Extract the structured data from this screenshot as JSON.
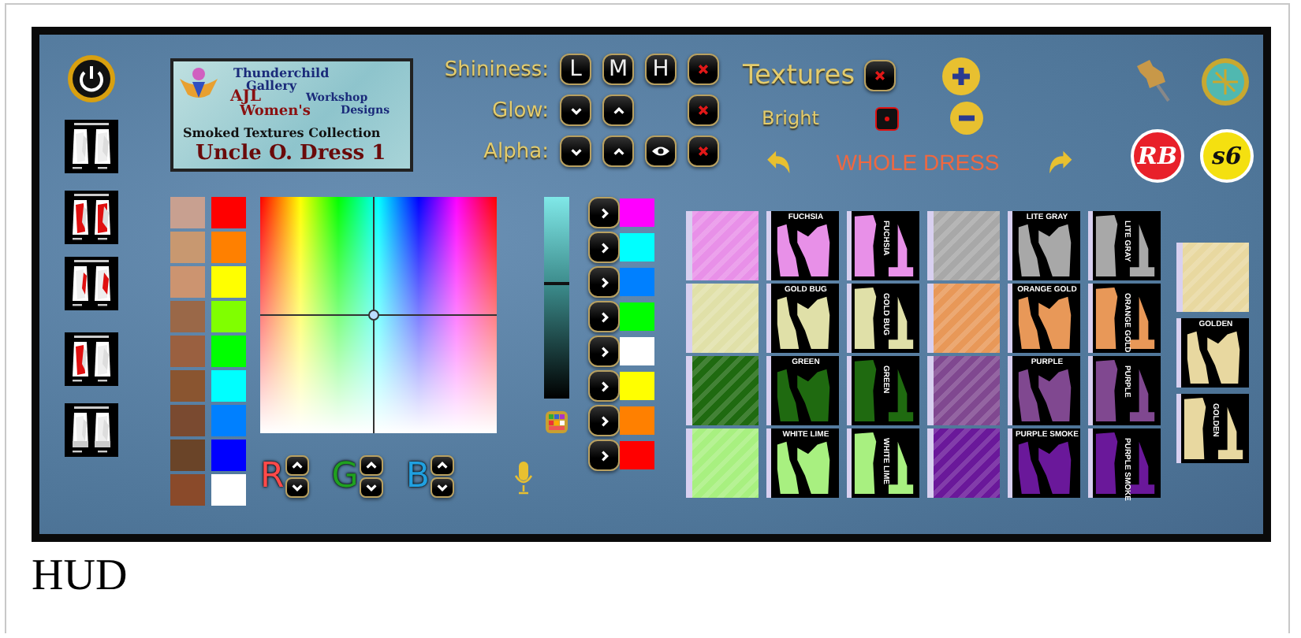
{
  "logo": {
    "title_lines": [
      "Thunderchild",
      "Gallery"
    ],
    "left": "AJL",
    "right_lines": [
      "Workshop",
      "Designs"
    ],
    "subtitle": "Women's",
    "collection": "Smoked Textures Collection",
    "product": "Uncle O. Dress 1"
  },
  "dress_parts": [
    {
      "kind": "whole"
    },
    {
      "kind": "main"
    },
    {
      "kind": "lacing"
    },
    {
      "kind": "side"
    },
    {
      "kind": "hip"
    }
  ],
  "shininess": {
    "label": "Shininess:",
    "buttons": [
      "L",
      "M",
      "H"
    ]
  },
  "glow": {
    "label": "Glow:"
  },
  "alpha": {
    "label": "Alpha:"
  },
  "textures": {
    "label": "Textures"
  },
  "bright": {
    "label": "Bright",
    "on": true
  },
  "target": {
    "label": "WHOLE DRESS"
  },
  "badges": [
    {
      "text": "RB",
      "color": "#e8202a"
    },
    {
      "text": "s6",
      "color": "#f4e010"
    }
  ],
  "skin_swatches": [
    {
      "color": "#c8a090"
    },
    {
      "color": "#c89870"
    },
    {
      "color": "#cc9470"
    },
    {
      "color": "#9a6848"
    },
    {
      "color": "#9a6040"
    },
    {
      "color": "#8a5530"
    },
    {
      "color": "#7a4a30"
    },
    {
      "color": "#6a4428"
    },
    {
      "color": "#8a4a2a"
    }
  ],
  "color_swatches": [
    {
      "color": "#ff0000"
    },
    {
      "color": "#ff8000"
    },
    {
      "color": "#ffff00"
    },
    {
      "color": "#80ff00"
    },
    {
      "color": "#00ff00"
    },
    {
      "color": "#00ffff"
    },
    {
      "color": "#0080ff"
    },
    {
      "color": "#0000ff"
    },
    {
      "color": "#ffffff"
    }
  ],
  "brightness_slider": {
    "level": 0.58
  },
  "rgb": [
    {
      "label": "R",
      "color": "#ff4a4a"
    },
    {
      "label": "G",
      "color": "#20a020"
    },
    {
      "label": "B",
      "color": "#20a0e0"
    }
  ],
  "presets": [
    {
      "color": "#ff00ff"
    },
    {
      "color": "#00ffff"
    },
    {
      "color": "#0080ff"
    },
    {
      "color": "#00ff00"
    },
    {
      "color": "#ffffff"
    },
    {
      "color": "#ffff00"
    },
    {
      "color": "#ff8000"
    },
    {
      "color": "#ff0000"
    }
  ],
  "texture_grid": [
    {
      "front_label": "FUCHSIA",
      "side_label": "FUCHSIA",
      "color": "#e890e8"
    },
    {
      "front_label": "LITE GRAY",
      "side_label": "LITE GRAY",
      "color": "#a8a8a8"
    },
    {
      "front_label": "GOLD BUG",
      "side_label": "GOLD BUG",
      "color": "#e0e0a8"
    },
    {
      "front_label": "ORANGE GOLD",
      "side_label": "ORANGE GOLD",
      "color": "#e89858"
    },
    {
      "front_label": "GREEN",
      "side_label": "GREEN",
      "color": "#1f6a10"
    },
    {
      "front_label": "PURPLE",
      "side_label": "PURPLE",
      "color": "#804890"
    },
    {
      "front_label": "WHITE LIME",
      "side_label": "WHITE LIME",
      "color": "#a8f080"
    },
    {
      "front_label": "PURPLE SMOKE",
      "side_label": "PURPLE SMOKE",
      "color": "#6a189a"
    }
  ],
  "golden": {
    "front_label": "GOLDEN",
    "side_label": "GOLDEN",
    "color": "#e8d8a0"
  },
  "caption": "HUD"
}
